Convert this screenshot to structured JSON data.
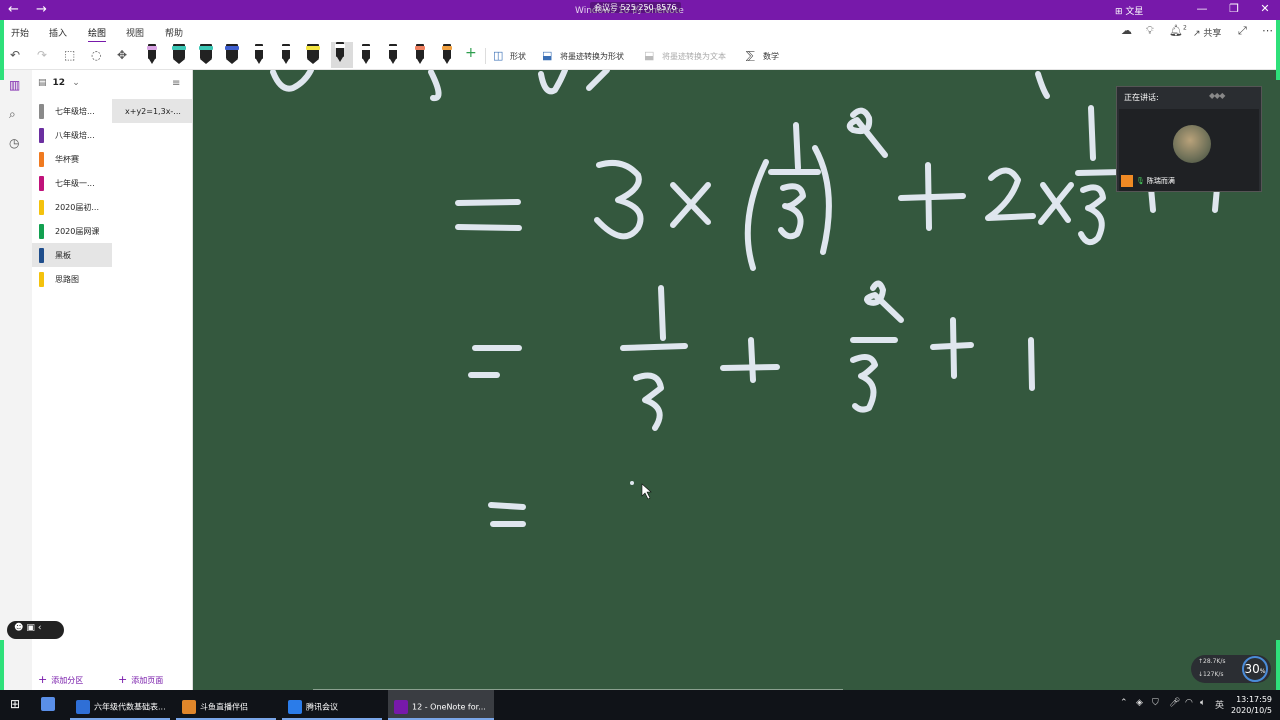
{
  "titlebar": {
    "back": "←",
    "forward": "→",
    "window_title": "Windows 10 的 OneNote",
    "meeting_id": "会议号 525 250 8576",
    "user": "文星",
    "minimize": "—",
    "restore": "❐",
    "close": "✕"
  },
  "ribbon": {
    "tabs": [
      "开始",
      "插入",
      "绘图",
      "视图",
      "帮助"
    ],
    "active_tab": "绘图",
    "share_label": "共享",
    "notif_count": "2"
  },
  "toolbar": {
    "shapes_label": "形状",
    "ink_to_shape_label": "将墨迹转换为形状",
    "ink_to_text_label": "将墨迹转换为文本",
    "math_label": "数学",
    "pens": [
      {
        "cap": "#d9a4e4",
        "body": "#222222"
      },
      {
        "cap": "#3cc7b5",
        "body": "#222222",
        "wide": true
      },
      {
        "cap": "#3cc7b5",
        "body": "#222222",
        "wide": true
      },
      {
        "cap": "#3f5fcf",
        "body": "#222222",
        "wide": true
      },
      {
        "cap": "#ffffff",
        "body": "#222222"
      },
      {
        "cap": "#ffffff",
        "body": "#222222"
      },
      {
        "cap": "#f4e542",
        "body": "#222222",
        "wide": true
      },
      {
        "cap": "#ffffff",
        "body": "#222222",
        "selected": true
      },
      {
        "cap": "#ffffff",
        "body": "#222222"
      },
      {
        "cap": "#ffffff",
        "body": "#222222"
      },
      {
        "cap": "#f08060",
        "body": "#222222"
      },
      {
        "cap": "#f0a040",
        "body": "#222222"
      }
    ]
  },
  "notebook": {
    "name": "12",
    "sections": [
      {
        "label": "七年级培...",
        "color": "#8a8a8a"
      },
      {
        "label": "八年级培...",
        "color": "#6b2fa0"
      },
      {
        "label": "华杯赛",
        "color": "#f07a20"
      },
      {
        "label": "七年级一...",
        "color": "#c0127a"
      },
      {
        "label": "2020届初...",
        "color": "#f4c20d"
      },
      {
        "label": "2020届网课",
        "color": "#12a050"
      },
      {
        "label": "黑板",
        "color": "#1f4e8c",
        "selected": true
      },
      {
        "label": "思路图",
        "color": "#f4c20d"
      }
    ],
    "pages": [
      {
        "label": "x+y2=1,3x-..."
      }
    ],
    "add_section_label": "添加分区",
    "add_page_label": "添加页面"
  },
  "video": {
    "title": "正在讲话:",
    "participant": "陈瑞而满"
  },
  "network": {
    "up": "↑28.7K/s",
    "down": "↓127K/s",
    "percent": "30",
    "percent_unit": "%"
  },
  "taskbar": {
    "items": [
      {
        "label": "六年级代数基础表...",
        "icon": "#2f6fd6"
      },
      {
        "label": "斗鱼直播伴侣",
        "icon": "#e0862a"
      },
      {
        "label": "腾讯会议",
        "icon": "#2b7ce9"
      },
      {
        "label": "12 - OneNote for...",
        "icon": "#7719aa",
        "active": true
      }
    ],
    "ime": "英",
    "time": "13:17:59",
    "date": "2020/10/5"
  }
}
